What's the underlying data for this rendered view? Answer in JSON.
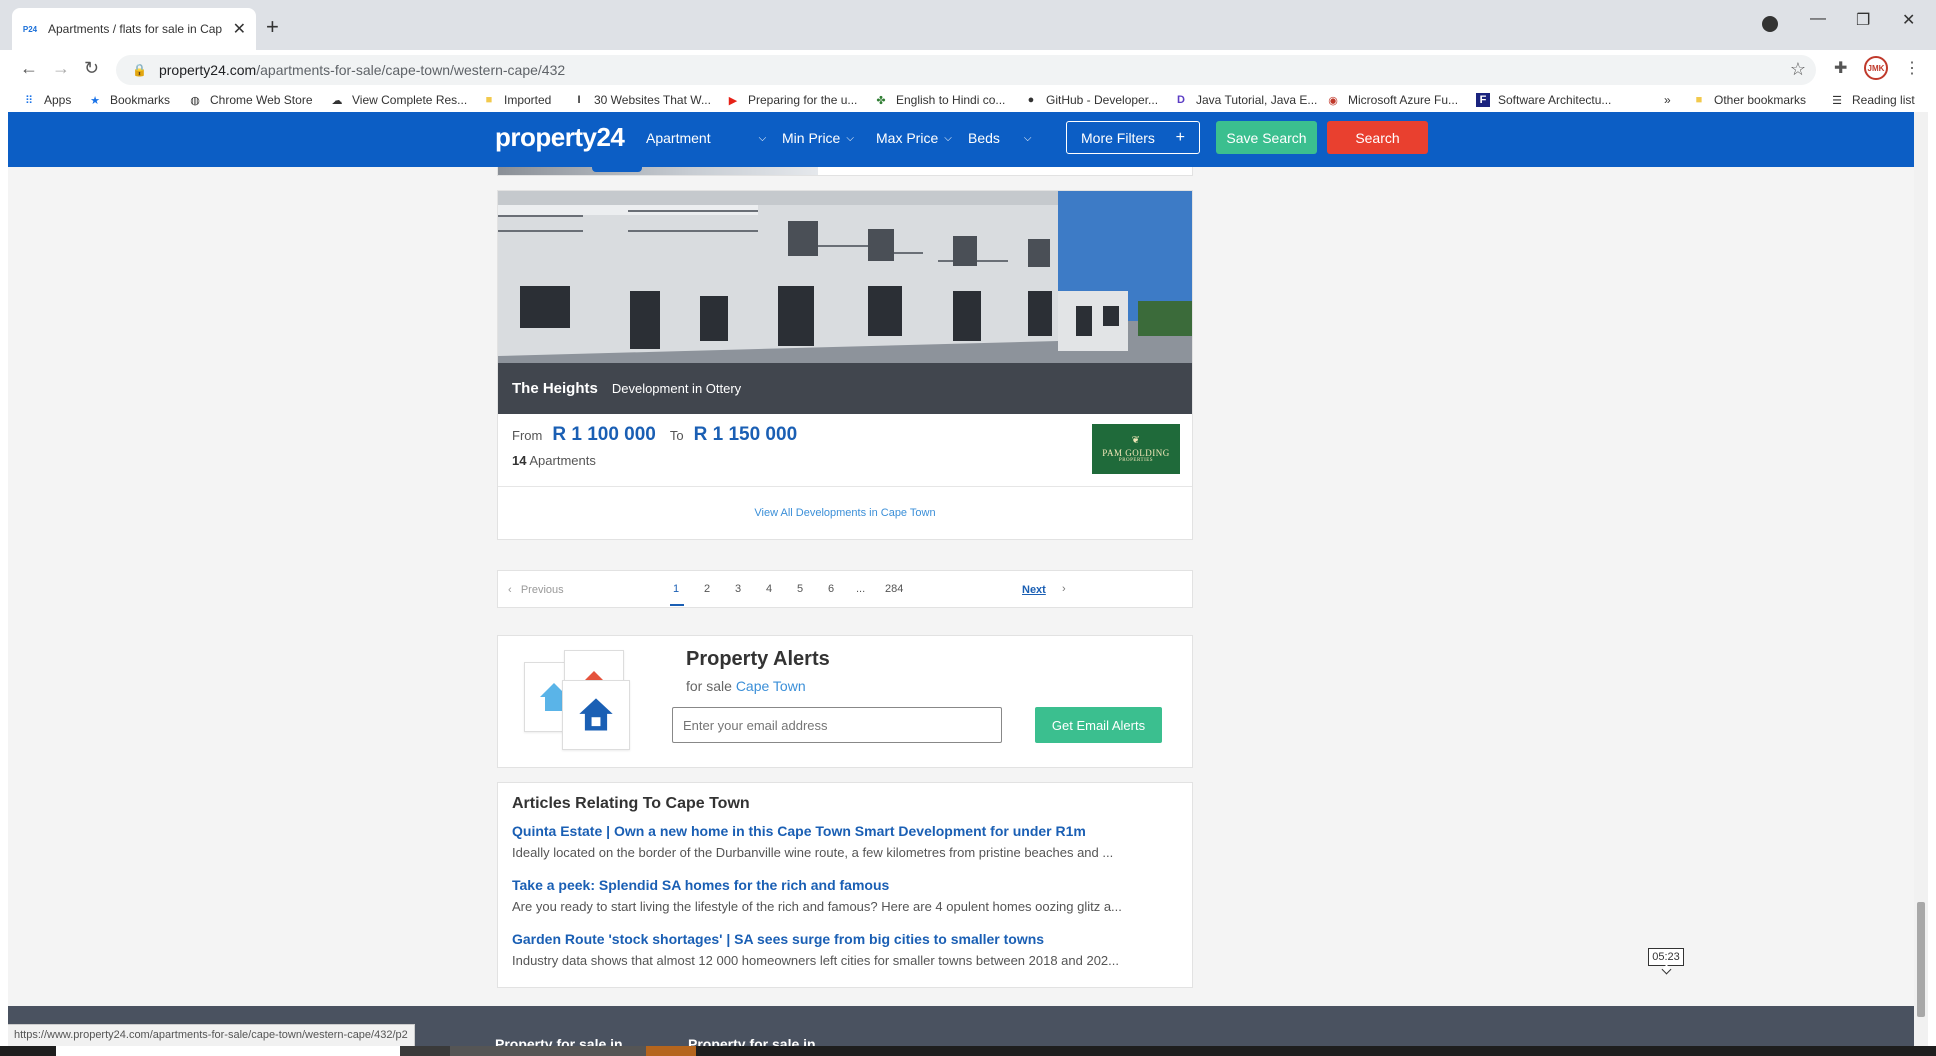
{
  "browser": {
    "tab_title": "Apartments / flats for sale in Cap",
    "favicon": "P24",
    "url_host": "property24.com",
    "url_path": "/apartments-for-sale/cape-town/western-cape/432",
    "avatar": "JMK",
    "bookmarks": [
      {
        "label": "Apps",
        "icon": "apps-grid-icon"
      },
      {
        "label": "Bookmarks",
        "icon": "star-icon"
      },
      {
        "label": "Chrome Web Store",
        "icon": "globe-icon"
      },
      {
        "label": "View Complete Res...",
        "icon": "cloud-icon"
      },
      {
        "label": "Imported",
        "icon": "folder-icon"
      },
      {
        "label": "30 Websites That W...",
        "icon": "text-icon"
      },
      {
        "label": "Preparing for the u...",
        "icon": "youtube-icon"
      },
      {
        "label": "English to Hindi co...",
        "icon": "leaf-icon"
      },
      {
        "label": "GitHub - Developer...",
        "icon": "github-icon"
      },
      {
        "label": "Java Tutorial, Java E...",
        "icon": "d-logo-icon"
      },
      {
        "label": "Microsoft Azure Fu...",
        "icon": "azure-icon"
      },
      {
        "label": "Software Architectu...",
        "icon": "f-logo-icon"
      }
    ],
    "more_bookmarks": "»",
    "other_bookmarks": "Other bookmarks",
    "reading_list": "Reading list",
    "status_url": "https://www.property24.com/apartments-for-sale/cape-town/western-cape/432/p2"
  },
  "header": {
    "logo": "property24",
    "property_type": "Apartment",
    "min_price": "Min Price",
    "max_price": "Max Price",
    "beds": "Beds",
    "more_filters": "More Filters",
    "save_search": "Save Search",
    "search": "Search"
  },
  "development": {
    "name": "The Heights",
    "subtitle": "Development in Ottery",
    "from_label": "From",
    "price_from": "R 1 100 000",
    "to_label": "To",
    "price_to": "R 1 150 000",
    "apartment_count": "14",
    "apartment_label": "Apartments",
    "agent": "PAM GOLDING",
    "agent_sub": "PROPERTIES",
    "view_all": "View All Developments in Cape Town"
  },
  "pagination": {
    "previous": "Previous",
    "pages": [
      "1",
      "2",
      "3",
      "4",
      "5",
      "6",
      "...",
      "284"
    ],
    "current": "1",
    "next": "Next"
  },
  "alerts": {
    "title": "Property Alerts",
    "sub_prefix": "for sale",
    "sub_location": "Cape Town",
    "email_placeholder": "Enter your email address",
    "button": "Get Email Alerts"
  },
  "articles": {
    "title": "Articles Relating To Cape Town",
    "items": [
      {
        "title": "Quinta Estate | Own a new home in this Cape Town Smart Development for under R1m",
        "desc": "Ideally located on the border of the Durbanville wine route, a few kilometres from pristine beaches and ..."
      },
      {
        "title": "Take a peek: Splendid SA homes for the rich and famous",
        "desc": "Are you ready to start living the lifestyle of the rich and famous? Here are 4 opulent homes oozing glitz a..."
      },
      {
        "title": "Garden Route 'stock shortages' | SA sees surge from big cities to smaller towns",
        "desc": "Industry data shows that almost 12 000 homeowners left cities for smaller towns between 2018 and 202..."
      }
    ]
  },
  "timer": "05:23",
  "footer": {
    "col1": "Property for sale in",
    "col2": "Property for sale in"
  },
  "colors": {
    "brand_blue": "#0c5ec5",
    "save_green": "#3bbf8f",
    "search_red": "#e9402f",
    "link_blue": "#1a5fb4"
  }
}
